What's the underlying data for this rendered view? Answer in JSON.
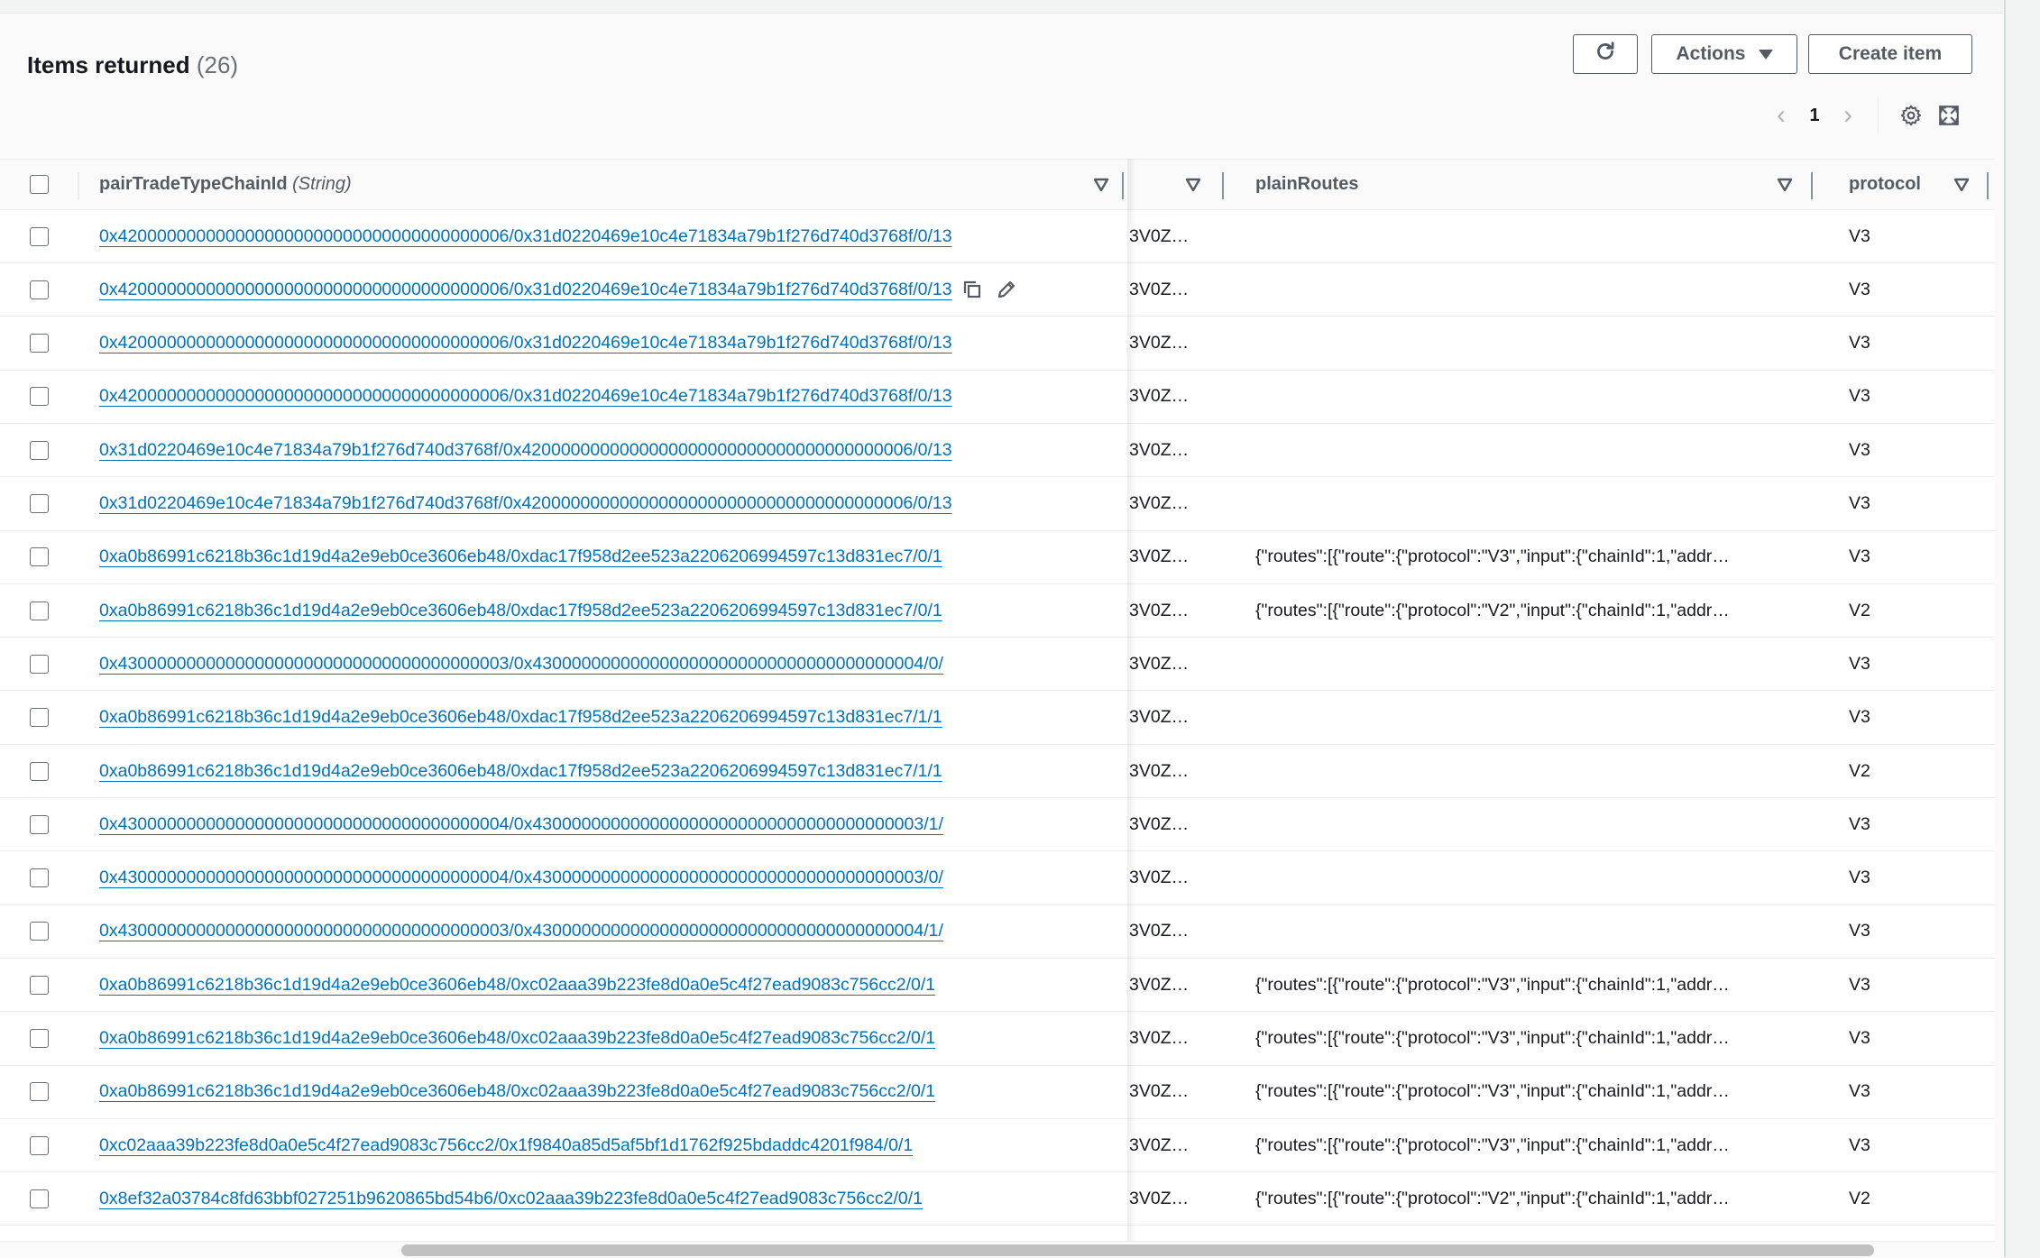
{
  "header": {
    "title": "Items returned",
    "count": "(26)",
    "refresh_icon": "refresh-icon",
    "actions_label": "Actions",
    "create_label": "Create item"
  },
  "pagination": {
    "prev_icon": "chevron-left-icon",
    "current_page": "1",
    "next_icon": "chevron-right-icon",
    "settings_icon": "gear-icon",
    "fullscreen_icon": "fullscreen-icon"
  },
  "columns": [
    {
      "name": "pairTradeTypeChainId",
      "type": "(String)"
    },
    {
      "name": ""
    },
    {
      "name": "plainRoutes"
    },
    {
      "name": "protocol"
    }
  ],
  "rows": [
    {
      "id": "0x4200000000000000000000000000000000000006/0x31d0220469e10c4e71834a79b1f276d740d3768f/0/13",
      "col2": "3V0Z…",
      "routes": "",
      "protocol": "V3"
    },
    {
      "id": "0x4200000000000000000000000000000000000006/0x31d0220469e10c4e71834a79b1f276d740d3768f/0/13",
      "col2": "3V0Z…",
      "routes": "",
      "protocol": "V3",
      "hovered": true
    },
    {
      "id": "0x4200000000000000000000000000000000000006/0x31d0220469e10c4e71834a79b1f276d740d3768f/0/13",
      "col2": "3V0Z…",
      "routes": "",
      "protocol": "V3"
    },
    {
      "id": "0x4200000000000000000000000000000000000006/0x31d0220469e10c4e71834a79b1f276d740d3768f/0/13",
      "col2": "3V0Z…",
      "routes": "",
      "protocol": "V3"
    },
    {
      "id": "0x31d0220469e10c4e71834a79b1f276d740d3768f/0x4200000000000000000000000000000000000006/0/13",
      "col2": "3V0Z…",
      "routes": "",
      "protocol": "V3"
    },
    {
      "id": "0x31d0220469e10c4e71834a79b1f276d740d3768f/0x4200000000000000000000000000000000000006/0/13",
      "col2": "3V0Z…",
      "routes": "",
      "protocol": "V3"
    },
    {
      "id": "0xa0b86991c6218b36c1d19d4a2e9eb0ce3606eb48/0xdac17f958d2ee523a2206206994597c13d831ec7/0/1",
      "col2": "3V0Z…",
      "routes": "{\"routes\":[{\"route\":{\"protocol\":\"V3\",\"input\":{\"chainId\":1,\"addr…",
      "protocol": "V3"
    },
    {
      "id": "0xa0b86991c6218b36c1d19d4a2e9eb0ce3606eb48/0xdac17f958d2ee523a2206206994597c13d831ec7/0/1",
      "col2": "3V0Z…",
      "routes": "{\"routes\":[{\"route\":{\"protocol\":\"V2\",\"input\":{\"chainId\":1,\"addr…",
      "protocol": "V2"
    },
    {
      "id": "0x4300000000000000000000000000000000000003/0x4300000000000000000000000000000000000004/0/",
      "col2": "3V0Z…",
      "routes": "",
      "protocol": "V3"
    },
    {
      "id": "0xa0b86991c6218b36c1d19d4a2e9eb0ce3606eb48/0xdac17f958d2ee523a2206206994597c13d831ec7/1/1",
      "col2": "3V0Z…",
      "routes": "",
      "protocol": "V3"
    },
    {
      "id": "0xa0b86991c6218b36c1d19d4a2e9eb0ce3606eb48/0xdac17f958d2ee523a2206206994597c13d831ec7/1/1",
      "col2": "3V0Z…",
      "routes": "",
      "protocol": "V2"
    },
    {
      "id": "0x4300000000000000000000000000000000000004/0x4300000000000000000000000000000000000003/1/",
      "col2": "3V0Z…",
      "routes": "",
      "protocol": "V3"
    },
    {
      "id": "0x4300000000000000000000000000000000000004/0x4300000000000000000000000000000000000003/0/",
      "col2": "3V0Z…",
      "routes": "",
      "protocol": "V3"
    },
    {
      "id": "0x4300000000000000000000000000000000000003/0x4300000000000000000000000000000000000004/1/",
      "col2": "3V0Z…",
      "routes": "",
      "protocol": "V3"
    },
    {
      "id": "0xa0b86991c6218b36c1d19d4a2e9eb0ce3606eb48/0xc02aaa39b223fe8d0a0e5c4f27ead9083c756cc2/0/1",
      "col2": "3V0Z…",
      "routes": "{\"routes\":[{\"route\":{\"protocol\":\"V3\",\"input\":{\"chainId\":1,\"addr…",
      "protocol": "V3"
    },
    {
      "id": "0xa0b86991c6218b36c1d19d4a2e9eb0ce3606eb48/0xc02aaa39b223fe8d0a0e5c4f27ead9083c756cc2/0/1",
      "col2": "3V0Z…",
      "routes": "{\"routes\":[{\"route\":{\"protocol\":\"V3\",\"input\":{\"chainId\":1,\"addr…",
      "protocol": "V3"
    },
    {
      "id": "0xa0b86991c6218b36c1d19d4a2e9eb0ce3606eb48/0xc02aaa39b223fe8d0a0e5c4f27ead9083c756cc2/0/1",
      "col2": "3V0Z…",
      "routes": "{\"routes\":[{\"route\":{\"protocol\":\"V3\",\"input\":{\"chainId\":1,\"addr…",
      "protocol": "V3"
    },
    {
      "id": "0xc02aaa39b223fe8d0a0e5c4f27ead9083c756cc2/0x1f9840a85d5af5bf1d1762f925bdaddc4201f984/0/1",
      "col2": "3V0Z…",
      "routes": "{\"routes\":[{\"route\":{\"protocol\":\"V3\",\"input\":{\"chainId\":1,\"addr…",
      "protocol": "V3"
    },
    {
      "id": "0x8ef32a03784c8fd63bbf027251b9620865bd54b6/0xc02aaa39b223fe8d0a0e5c4f27ead9083c756cc2/0/1",
      "col2": "3V0Z…",
      "routes": "{\"routes\":[{\"route\":{\"protocol\":\"V2\",\"input\":{\"chainId\":1,\"addr…",
      "protocol": "V2"
    }
  ],
  "row_actions": {
    "copy_icon": "copy-icon",
    "edit_icon": "pencil-icon"
  },
  "colors": {
    "link": "#0073bb",
    "text": "#16191f",
    "muted": "#687078",
    "button_border": "#545b64",
    "panel_bg": "#fafafa"
  }
}
